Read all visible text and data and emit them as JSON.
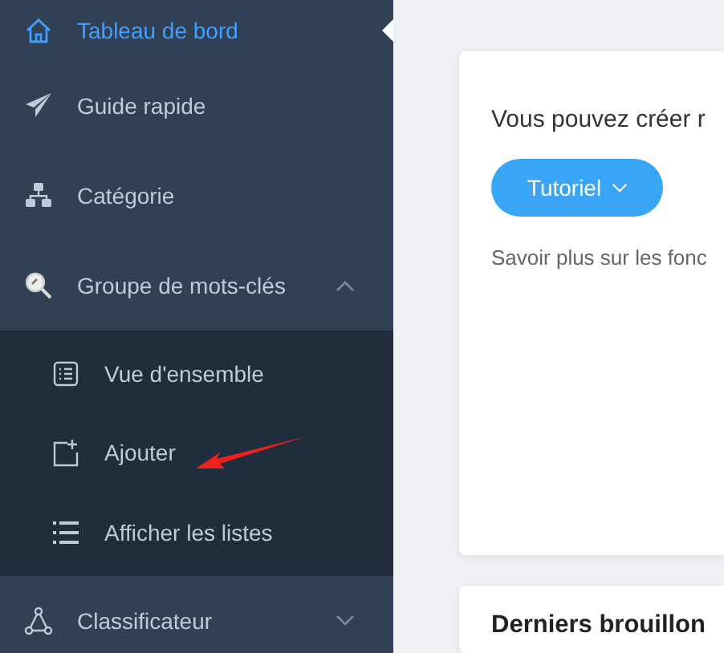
{
  "sidebar": {
    "items": [
      {
        "label": "Tableau de bord",
        "selected": true
      },
      {
        "label": "Guide rapide",
        "selected": false
      },
      {
        "label": "Catégorie",
        "selected": false
      },
      {
        "label": "Groupe de mots-clés",
        "selected": false,
        "expanded": true,
        "children": [
          {
            "label": "Vue d'ensemble",
            "selected": false
          },
          {
            "label": "Ajouter",
            "selected": false
          },
          {
            "label": "Afficher les listes",
            "selected": false
          }
        ]
      },
      {
        "label": "Classificateur",
        "selected": false,
        "expanded": false
      }
    ]
  },
  "intro_card": {
    "text": "Vous pouvez créer r",
    "button": "Tutoriel",
    "note": "Savoir plus sur les fonc"
  },
  "drafts_card": {
    "title": "Derniers brouillon"
  }
}
